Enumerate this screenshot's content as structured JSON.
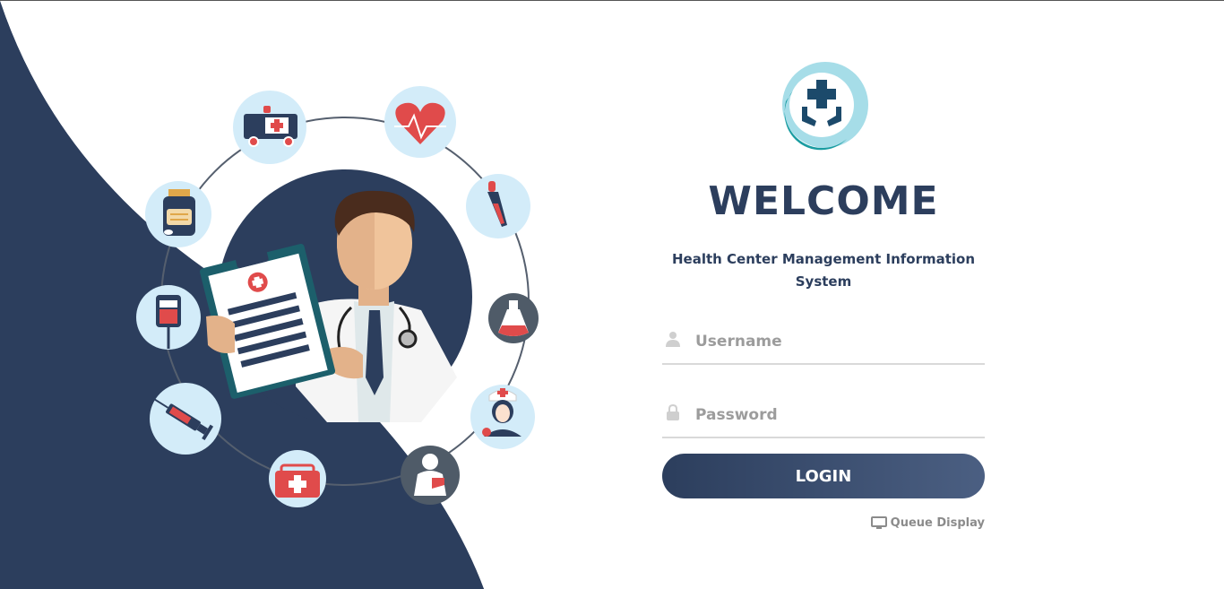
{
  "welcome": {
    "title": "WELCOME",
    "subtitle": "Health Center Management Information System"
  },
  "form": {
    "username_placeholder": "Username",
    "password_placeholder": "Password",
    "login_label": "LOGIN"
  },
  "footer": {
    "queue_display_label": "Queue Display"
  },
  "illustration": {
    "icons": [
      "ambulance-icon",
      "heart-rate-icon",
      "dropper-icon",
      "flask-icon",
      "nurse-icon",
      "patient-icon",
      "first-aid-kit-icon",
      "syringe-icon",
      "blood-bag-icon",
      "medicine-bottle-icon"
    ]
  },
  "colors": {
    "primary": "#2c3e5d",
    "accent_teal": "#1aa5a5",
    "icon_bg": "#d3ecf9",
    "danger": "#e04b4b"
  }
}
